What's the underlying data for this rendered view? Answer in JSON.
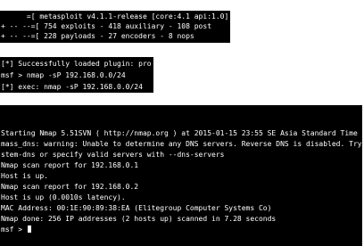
{
  "banner": {
    "line1": "      =[ metasploit v4.1.1-release [core:4.1 api:1.0]",
    "line2": "+ -- --=[ 754 exploits - 418 auxiliary - 108 post",
    "line3": "+ -- --=[ 228 payloads - 27 encoders - 8 nops"
  },
  "plugin": {
    "loaded": "[*] Successfully loaded plugin: pro",
    "prompt_cmd": "msf > nmap -sP 192.168.0.0/24",
    "exec": "[*] exec: nmap -sP 192.168.0.0/24"
  },
  "nmap_output": {
    "start": "Starting Nmap 5.51SVN ( http://nmap.org ) at 2015-01-15 23:55 SE Asia Standard Time",
    "warn1": "mass_dns: warning: Unable to determine any DNS servers. Reverse DNS is disabled. Try using --s",
    "warn2": "stem-dns or specify valid servers with --dns-servers",
    "report1": "Nmap scan report for 192.168.0.1",
    "up1": "Host is up.",
    "report2": "Nmap scan report for 192.168.0.2",
    "up2": "Host is up (0.0010s latency).",
    "mac": "MAC Address: 00:1E:90:89:38:EA (Elitegroup Computer Systems Co)",
    "done": "Nmap done: 256 IP addresses (2 hosts up) scanned in 7.28 seconds",
    "final_prompt": "msf > "
  }
}
